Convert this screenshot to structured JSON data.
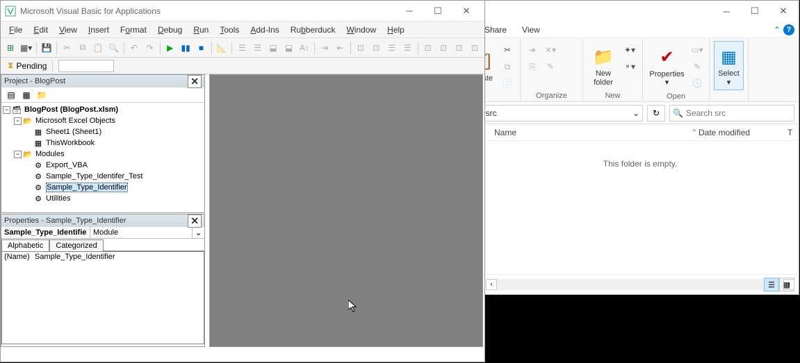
{
  "vba": {
    "title": "Microsoft Visual Basic for Applications",
    "menu": [
      "File",
      "Edit",
      "View",
      "Insert",
      "Format",
      "Debug",
      "Run",
      "Tools",
      "Add-Ins",
      "Rubberduck",
      "Window",
      "Help"
    ],
    "pending": "Pending",
    "project": {
      "header": "Project - BlogPost",
      "root": "BlogPost (BlogPost.xlsm)",
      "excel_objects": "Microsoft Excel Objects",
      "sheet1": "Sheet1 (Sheet1)",
      "thisworkbook": "ThisWorkbook",
      "modules": "Modules",
      "mod1": "Export_VBA",
      "mod2": "Sample_Type_Identifer_Test",
      "mod3": "Sample_Type_Identifier",
      "mod4": "Utilities"
    },
    "props": {
      "header": "Properties - Sample_Type_Identifier",
      "obj_name": "Sample_Type_Identifie",
      "obj_type": "Module",
      "tab_alpha": "Alphabetic",
      "tab_cat": "Categorized",
      "row_key": "(Name)",
      "row_val": "Sample_Type_Identifier"
    }
  },
  "explorer": {
    "tabs": {
      "share": "Share",
      "view": "View"
    },
    "ribbon": {
      "paste": "Paste",
      "newfolder": "New\nfolder",
      "properties": "Properties",
      "select": "Select",
      "g_organize": "Organize",
      "g_new": "New",
      "g_open": "Open"
    },
    "crumb": {
      "src": "src",
      "chevron": "›"
    },
    "search_placeholder": "Search src",
    "cols": {
      "name": "Name",
      "date": "Date modified",
      "type": "T"
    },
    "empty": "This folder is empty."
  }
}
